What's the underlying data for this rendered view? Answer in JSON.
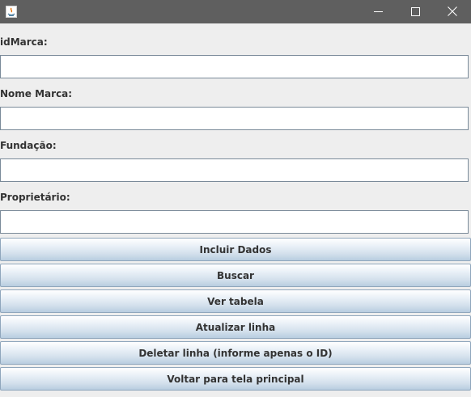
{
  "window": {
    "app_icon": "java-icon",
    "controls": [
      "minimize-icon",
      "maximize-icon",
      "close-icon"
    ]
  },
  "form": {
    "fields": [
      {
        "label": "idMarca:",
        "value": ""
      },
      {
        "label": "Nome Marca:",
        "value": ""
      },
      {
        "label": "Fundação:",
        "value": ""
      },
      {
        "label": "Proprietário:",
        "value": ""
      }
    ]
  },
  "buttons": {
    "incluir": "Incluir Dados",
    "buscar": "Buscar",
    "ver_tabela": "Ver tabela",
    "atualizar": "Atualizar linha",
    "deletar": "Deletar linha (informe apenas o ID)",
    "voltar": "Voltar para tela principal"
  },
  "colors": {
    "titlebar": "#5f5f5f",
    "window_bg": "#eeeeee",
    "button_border": "#8fa6bc"
  }
}
